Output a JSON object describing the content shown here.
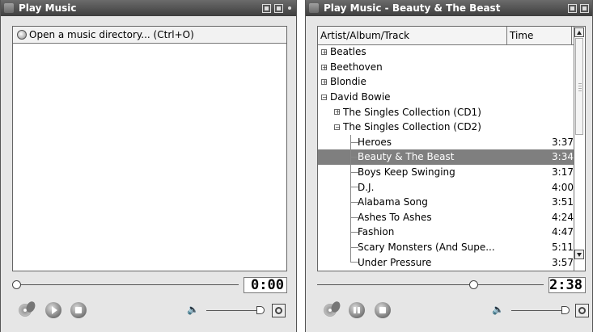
{
  "left_window": {
    "title": "Play Music",
    "open_item": "Open a music directory... (Ctrl+O)",
    "time_display": "0:00",
    "seek_fraction": 0.0,
    "volume_fraction": 1.0
  },
  "right_window": {
    "title": "Play Music - Beauty & The Beast",
    "columns": {
      "track": "Artist/Album/Track",
      "time": "Time"
    },
    "time_display": "2:38",
    "seek_fraction": 0.7,
    "volume_fraction": 1.0,
    "rows": [
      {
        "label": "Beatles",
        "time": "",
        "level": 0,
        "expander": "+"
      },
      {
        "label": "Beethoven",
        "time": "",
        "level": 0,
        "expander": "+"
      },
      {
        "label": "Blondie",
        "time": "",
        "level": 0,
        "expander": "+"
      },
      {
        "label": "David Bowie",
        "time": "",
        "level": 0,
        "expander": "-"
      },
      {
        "label": "The Singles Collection (CD1)",
        "time": "",
        "level": 1,
        "expander": "+"
      },
      {
        "label": "The Singles Collection (CD2)",
        "time": "",
        "level": 1,
        "expander": "-"
      },
      {
        "label": "Heroes",
        "time": "3:37",
        "level": 2,
        "expander": ""
      },
      {
        "label": "Beauty & The Beast",
        "time": "3:34",
        "level": 2,
        "expander": "",
        "selected": true
      },
      {
        "label": "Boys Keep Swinging",
        "time": "3:17",
        "level": 2,
        "expander": ""
      },
      {
        "label": "D.J.",
        "time": "4:00",
        "level": 2,
        "expander": ""
      },
      {
        "label": "Alabama Song",
        "time": "3:51",
        "level": 2,
        "expander": ""
      },
      {
        "label": "Ashes To Ashes",
        "time": "4:24",
        "level": 2,
        "expander": ""
      },
      {
        "label": "Fashion",
        "time": "4:47",
        "level": 2,
        "expander": ""
      },
      {
        "label": "Scary Monsters (And Supe...",
        "time": "5:11",
        "level": 2,
        "expander": ""
      },
      {
        "label": "Under Pressure",
        "time": "3:57",
        "level": 2,
        "expander": ""
      }
    ]
  }
}
